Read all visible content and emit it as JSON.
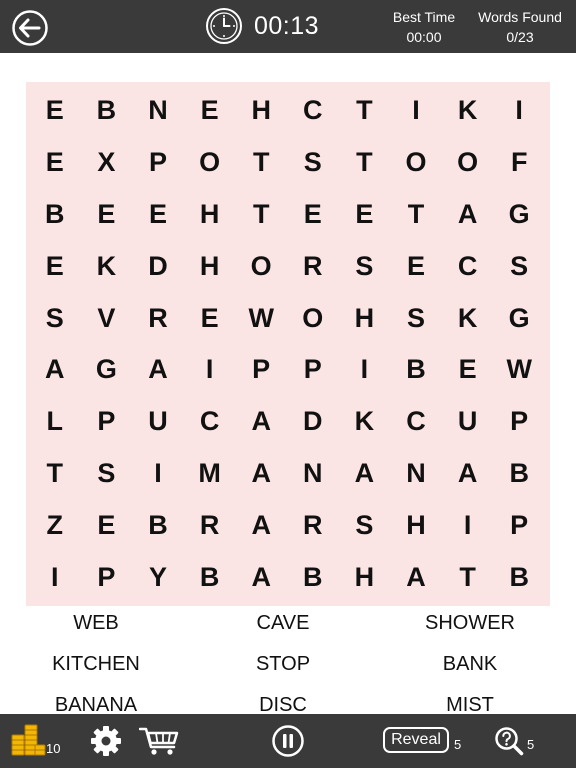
{
  "header": {
    "timer": "00:13",
    "best_time_label": "Best Time",
    "best_time_value": "00:00",
    "words_found_label": "Words Found",
    "words_found_value": "0/23",
    "icons": {
      "back": "back-arrow-icon",
      "clock": "clock-icon"
    }
  },
  "grid": [
    [
      "E",
      "B",
      "N",
      "E",
      "H",
      "C",
      "T",
      "I",
      "K",
      "I"
    ],
    [
      "E",
      "X",
      "P",
      "O",
      "T",
      "S",
      "T",
      "O",
      "O",
      "F"
    ],
    [
      "B",
      "E",
      "E",
      "H",
      "T",
      "E",
      "E",
      "T",
      "A",
      "G"
    ],
    [
      "E",
      "K",
      "D",
      "H",
      "O",
      "R",
      "S",
      "E",
      "C",
      "S"
    ],
    [
      "S",
      "V",
      "R",
      "E",
      "W",
      "O",
      "H",
      "S",
      "K",
      "G"
    ],
    [
      "A",
      "G",
      "A",
      "I",
      "P",
      "P",
      "I",
      "B",
      "E",
      "W"
    ],
    [
      "L",
      "P",
      "U",
      "C",
      "A",
      "D",
      "K",
      "C",
      "U",
      "P"
    ],
    [
      "T",
      "S",
      "I",
      "M",
      "A",
      "N",
      "A",
      "N",
      "A",
      "B"
    ],
    [
      "Z",
      "E",
      "B",
      "R",
      "A",
      "R",
      "S",
      "H",
      "I",
      "P"
    ],
    [
      "I",
      "P",
      "Y",
      "B",
      "A",
      "B",
      "H",
      "A",
      "T",
      "B"
    ]
  ],
  "words": [
    "WEB",
    "CAVE",
    "SHOWER",
    "KITCHEN",
    "STOP",
    "BANK",
    "BANANA",
    "DISC",
    "MIST"
  ],
  "footer": {
    "coins": "10",
    "reveal_label": "Reveal",
    "reveal_count": "5",
    "hint_count": "5",
    "icons": {
      "coins": "coins-icon",
      "settings": "gear-icon",
      "shop": "cart-icon",
      "pause": "pause-icon",
      "hint": "magnifier-question-icon"
    }
  },
  "colors": {
    "bar": "#3a3a3a",
    "grid_bg": "#fbe5e4",
    "text": "#111111"
  }
}
